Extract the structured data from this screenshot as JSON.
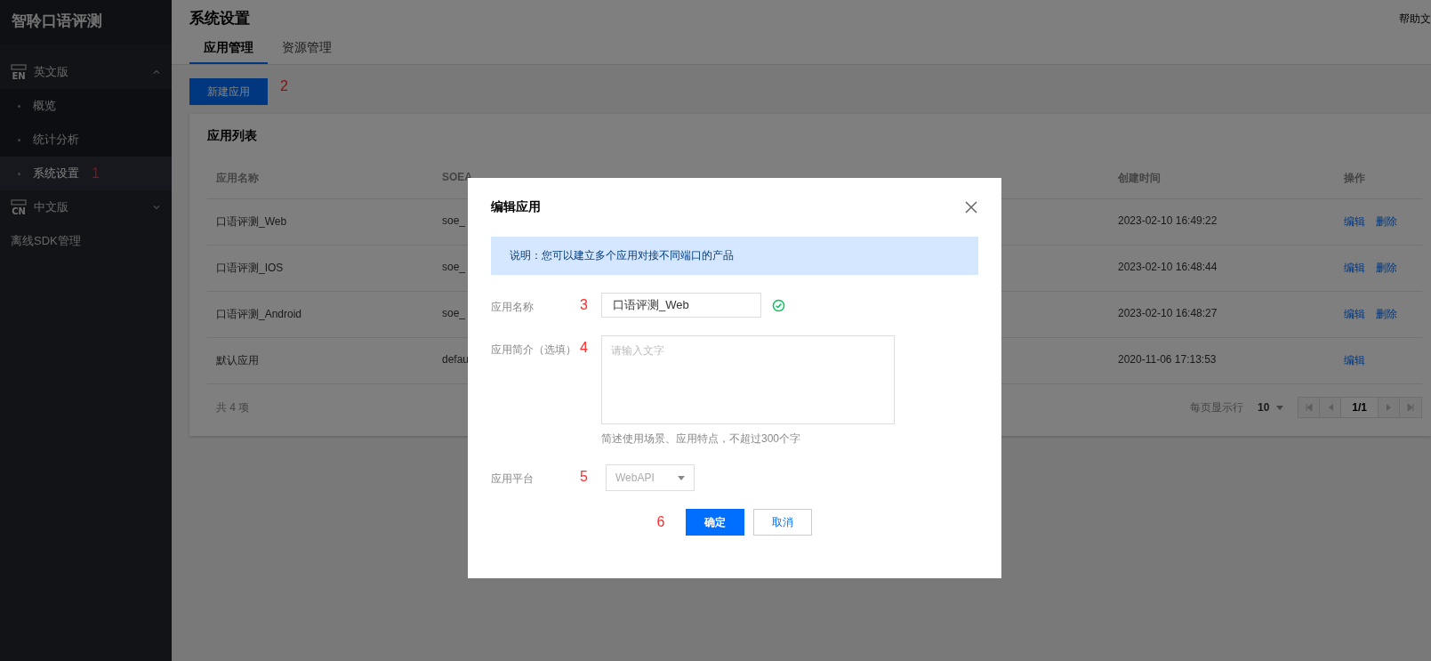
{
  "sidebar": {
    "brand": "智聆口语评测",
    "groups": [
      {
        "label": "英文版",
        "icon_text": "EN",
        "expanded": true,
        "children": [
          {
            "label": "概览",
            "selected": false
          },
          {
            "label": "统计分析",
            "selected": false
          },
          {
            "label": "系统设置",
            "selected": true,
            "annotation": "1"
          }
        ]
      },
      {
        "label": "中文版",
        "icon_text": "CN",
        "expanded": false
      }
    ],
    "links": [
      {
        "label": "离线SDK管理"
      }
    ]
  },
  "header": {
    "title": "系统设置",
    "help_link": "帮助文"
  },
  "tabs": [
    {
      "label": "应用管理",
      "selected": true
    },
    {
      "label": "资源管理",
      "selected": false
    }
  ],
  "new_button": {
    "label": "新建应用",
    "annotation": "2"
  },
  "table": {
    "title": "应用列表",
    "columns": [
      "应用名称",
      "SOEA",
      "创建时间",
      "操作"
    ],
    "rows": [
      {
        "name": "口语评测_Web",
        "app_id": "soe_",
        "created": "2023-02-10 16:49:22",
        "actions": [
          "编辑",
          "删除"
        ]
      },
      {
        "name": "口语评测_IOS",
        "app_id": "soe_",
        "created": "2023-02-10 16:48:44",
        "actions": [
          "编辑",
          "删除"
        ]
      },
      {
        "name": "口语评测_Android",
        "app_id": "soe_",
        "created": "2023-02-10 16:48:27",
        "actions": [
          "编辑",
          "删除"
        ]
      },
      {
        "name": "默认应用",
        "app_id": "defau",
        "created": "2020-11-06 17:13:53",
        "actions": [
          "编辑"
        ]
      }
    ],
    "total": "共 4 项",
    "pagination": {
      "page_size_label": "每页显示行",
      "page_size": "10",
      "page": "1/1"
    }
  },
  "dialog": {
    "title": "编辑应用",
    "notice": "说明：您可以建立多个应用对接不同端口的产品",
    "fields": [
      {
        "kind": "input",
        "label": "应用名称",
        "annotation": "3",
        "value": "口语评测_Web",
        "valid": true
      },
      {
        "kind": "textarea",
        "label": "应用简介（选填）",
        "annotation": "4",
        "placeholder": "请输入文字",
        "hint": "简述使用场景、应用特点，不超过300个字"
      },
      {
        "kind": "select",
        "label": "应用平台",
        "annotation": "5",
        "value": "WebAPI",
        "disabled": true
      }
    ],
    "footer_annotation": "6",
    "buttons": [
      {
        "label": "确定",
        "kind": "primary"
      },
      {
        "label": "取消",
        "kind": "secondary"
      }
    ]
  }
}
